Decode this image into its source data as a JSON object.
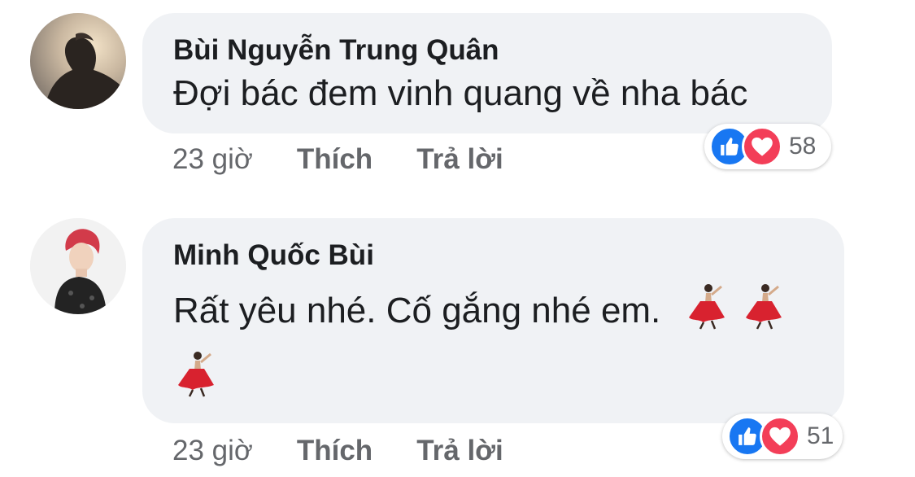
{
  "comments": [
    {
      "author": "Bùi Nguyễn Trung Quân",
      "text": "Đợi bác đem vinh quang về nha bác",
      "time": "23 giờ",
      "like_label": "Thích",
      "reply_label": "Trả lời",
      "reaction_count": "58",
      "reactions": [
        "like-icon",
        "love-icon"
      ]
    },
    {
      "author": "Minh Quốc Bùi",
      "text": "Rất yêu nhé. Cố gắng nhé em.",
      "emoji": [
        "dancer-emoji",
        "dancer-emoji",
        "dancer-emoji"
      ],
      "time": "23 giờ",
      "like_label": "Thích",
      "reply_label": "Trả lời",
      "reaction_count": "51",
      "reactions": [
        "like-icon",
        "love-icon"
      ]
    }
  ],
  "colors": {
    "bubble": "#f0f2f5",
    "like": "#1877f2",
    "love": "#f33e58",
    "meta_text": "#65676b"
  }
}
